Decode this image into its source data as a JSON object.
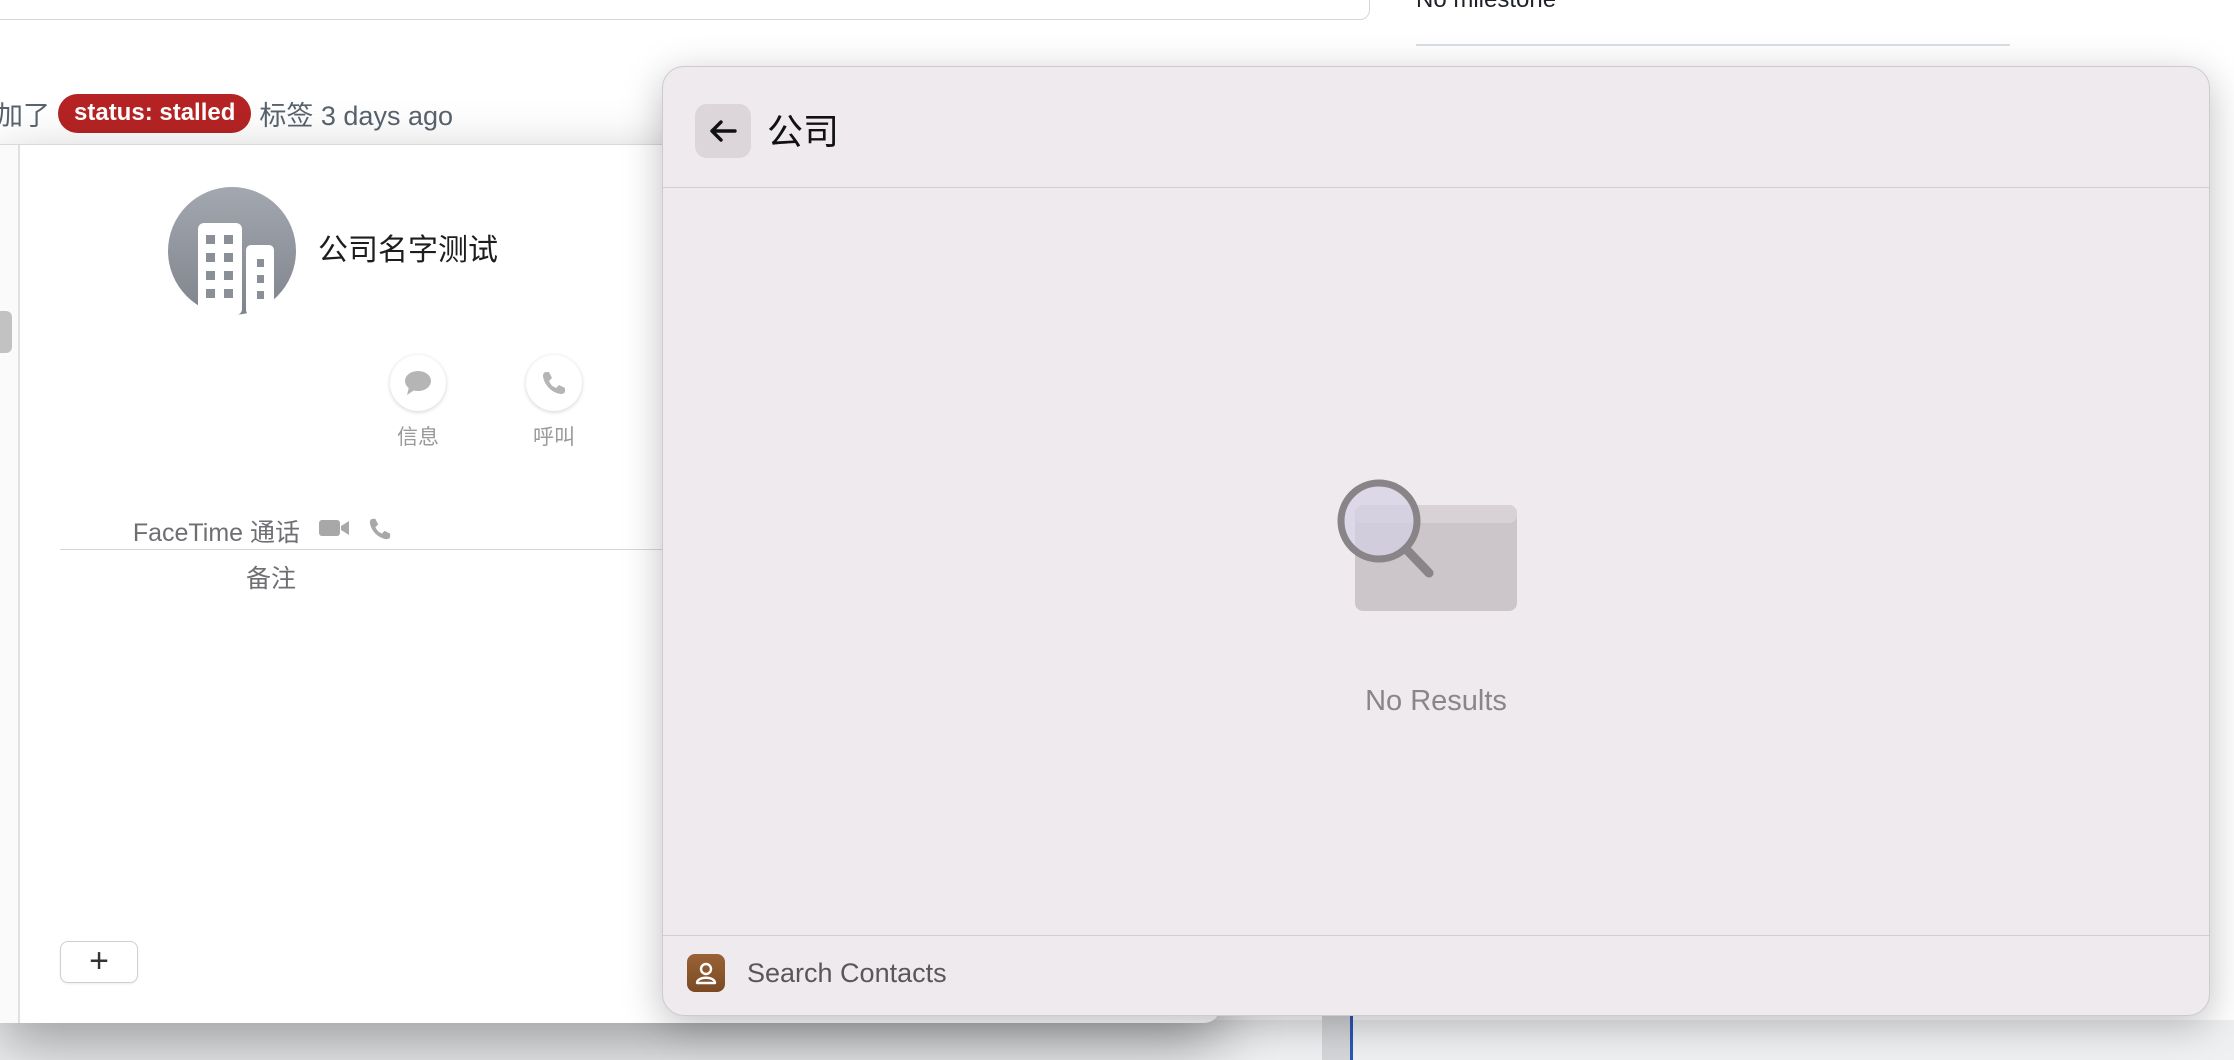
{
  "background_page": {
    "milestone_text": "No milestone",
    "timeline": {
      "prefix": "加了",
      "label_badge": "status: stalled",
      "suffix": "标签 3 days ago"
    },
    "colors": {
      "label_badge": "#b62324"
    }
  },
  "contact_card": {
    "name": "公司名字测试",
    "avatar_icon": "building-icon",
    "actions": [
      {
        "label": "信息",
        "icon": "message-bubble-icon"
      },
      {
        "label": "呼叫",
        "icon": "phone-icon"
      }
    ],
    "facetime_label": "FaceTime 通话",
    "notes_label": "备注",
    "add_button": "+"
  },
  "search_panel": {
    "title": "公司",
    "back_icon": "arrow-left-icon",
    "empty_state": {
      "icon": "magnifier-over-window-icon",
      "text": "No Results"
    },
    "footer": {
      "app_icon": "contacts-app-icon",
      "label": "Search Contacts"
    }
  }
}
